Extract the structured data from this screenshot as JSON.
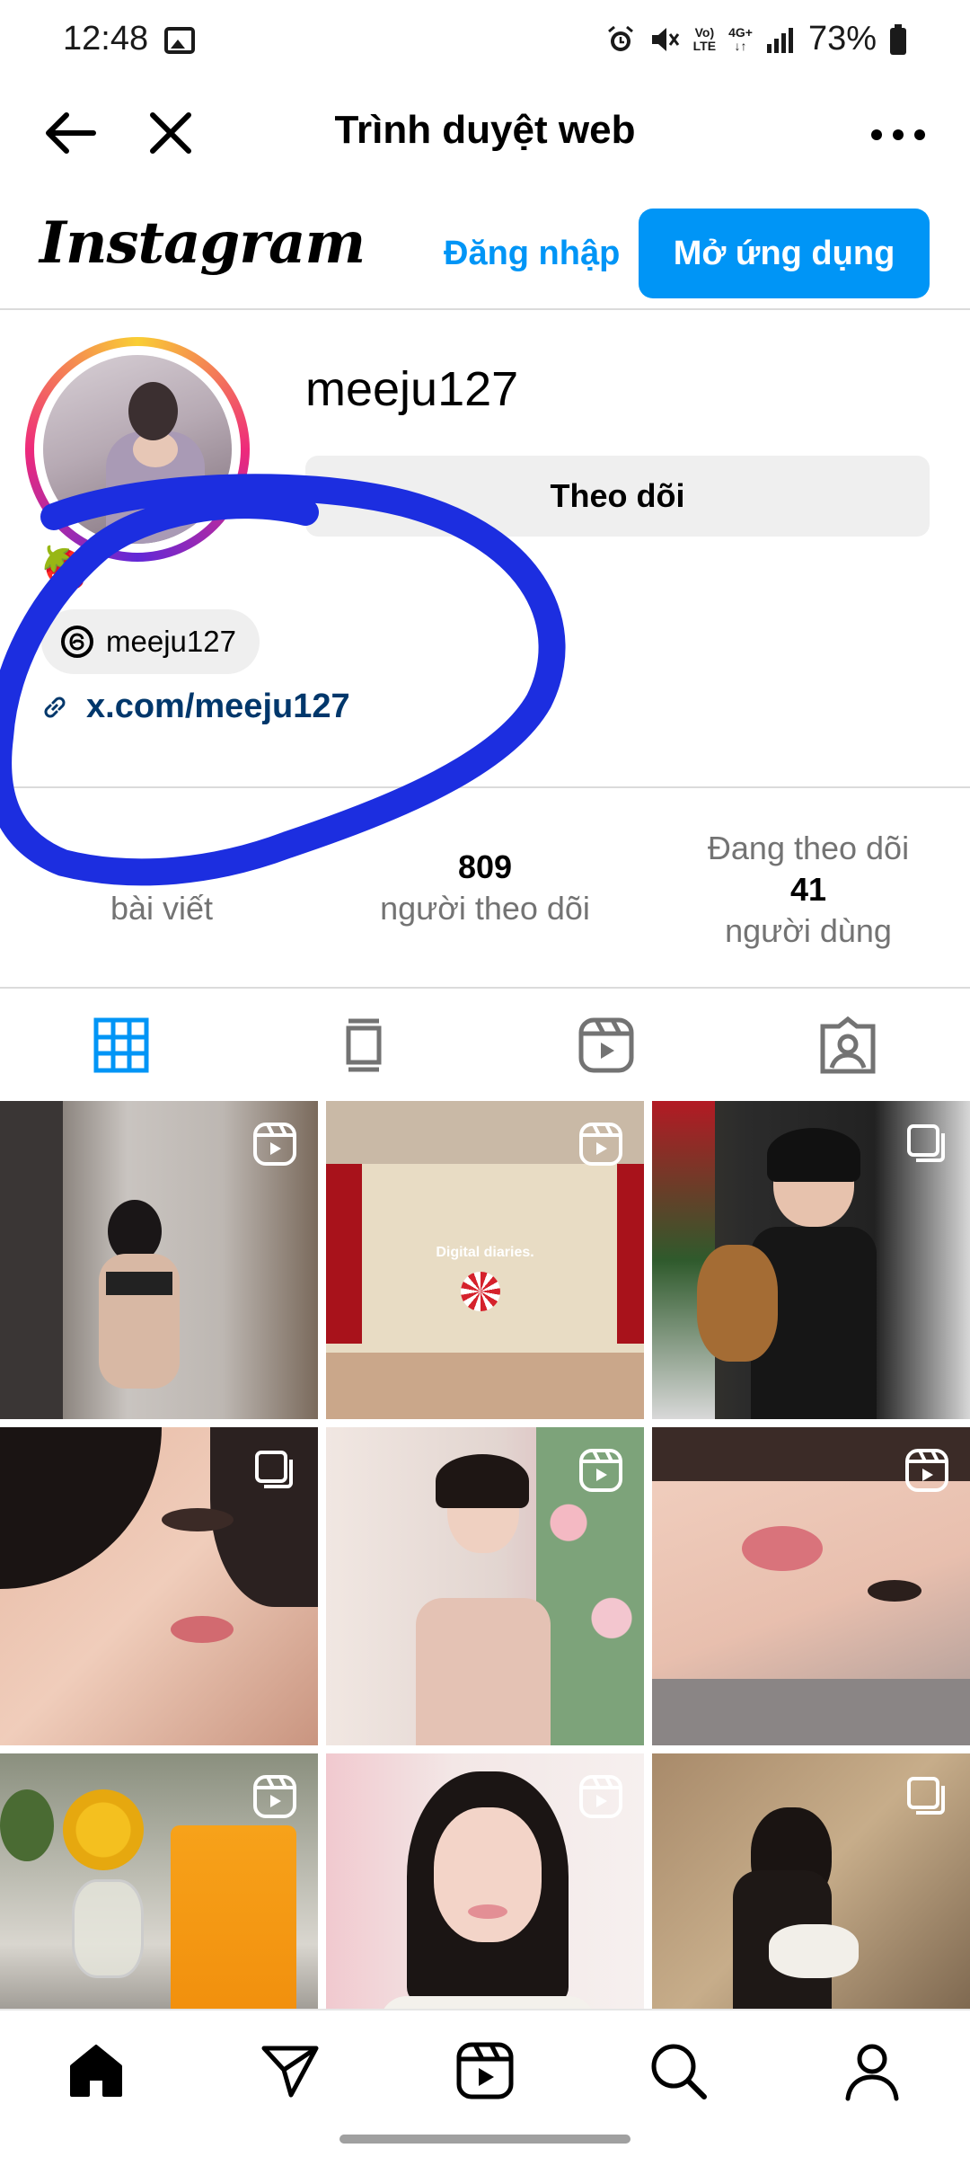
{
  "status_bar": {
    "time": "12:48",
    "network_label_top": "Vo)",
    "network_label_bottom": "LTE",
    "network_type": "4G+",
    "battery": "73%"
  },
  "browser": {
    "title": "Trình duyệt web"
  },
  "ig_header": {
    "logo": "Instagram",
    "login": "Đăng nhập",
    "open_app": "Mở ứng dụng",
    "accent_color": "#0095f6"
  },
  "profile": {
    "username": "meeju127",
    "follow_label": "Theo dõi",
    "bio_emoji": "🍓",
    "threads_handle": "meeju127",
    "link": "x.com/meeju127"
  },
  "stats": {
    "posts_label": "bài viết",
    "followers_count": "809",
    "followers_label": "người theo dõi",
    "following_prefix": "Đang theo dõi",
    "following_count": "41",
    "following_label": "người dùng"
  },
  "tabs": [
    {
      "icon": "grid-icon",
      "active": true
    },
    {
      "icon": "feed-icon",
      "active": false
    },
    {
      "icon": "reels-icon",
      "active": false
    },
    {
      "icon": "tagged-icon",
      "active": false
    }
  ],
  "grid_posts": [
    {
      "badge": "reel-icon"
    },
    {
      "badge": "reel-icon",
      "caption": "Digital diaries."
    },
    {
      "badge": "carousel-icon"
    },
    {
      "badge": "carousel-icon"
    },
    {
      "badge": "reel-icon"
    },
    {
      "badge": "reel-icon"
    },
    {
      "badge": "reel-icon"
    },
    {
      "badge": "reel-icon"
    },
    {
      "badge": "carousel-icon"
    }
  ],
  "bottom_nav": [
    "home-icon",
    "send-icon",
    "reels-icon",
    "search-icon",
    "profile-icon"
  ],
  "annotation_color": "#1c2ee0"
}
